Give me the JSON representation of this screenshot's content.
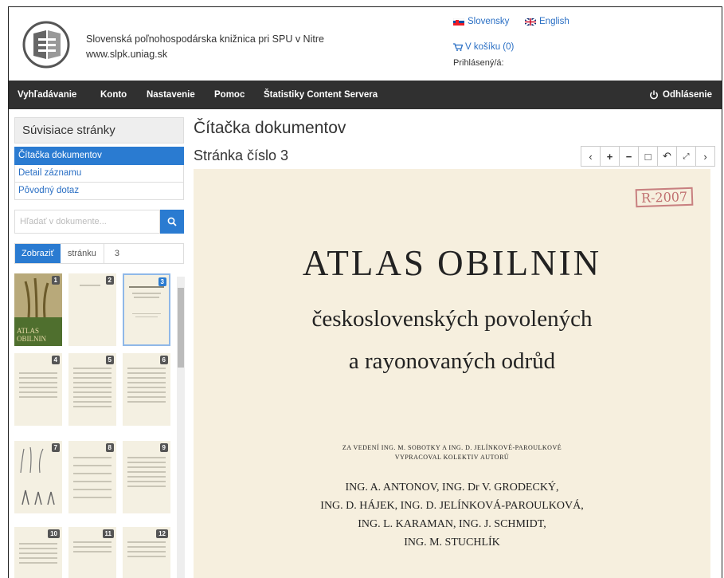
{
  "header": {
    "library_name": "Slovenská poľnohospodárska knižnica pri SPU v Nitre",
    "library_url": "www.slpk.uniag.sk",
    "lang_sk": "Slovensky",
    "lang_en": "English",
    "cart": "V košíku (0)",
    "logged_in": "Prihlásený/á:"
  },
  "nav": {
    "items": [
      "Vyhľadávanie",
      "Konto",
      "Nastavenie",
      "Pomoc",
      "Štatistiky Content Servera"
    ],
    "logout": "Odhlásenie"
  },
  "sidebar": {
    "title": "Súvisiace stránky",
    "links": [
      "Čítačka dokumentov",
      "Detail záznamu",
      "Pôvodný dotaz"
    ],
    "search_placeholder": "Hľadať v dokumente...",
    "show_button": "Zobraziť",
    "page_label": "stránku",
    "page_value": "3",
    "thumbnails": [
      {
        "num": "1",
        "cover_title": "ATLAS OBILNIN"
      },
      {
        "num": "2"
      },
      {
        "num": "3",
        "selected": true
      },
      {
        "num": "4"
      },
      {
        "num": "5"
      },
      {
        "num": "6"
      },
      {
        "num": "7"
      },
      {
        "num": "8"
      },
      {
        "num": "9"
      },
      {
        "num": "10"
      },
      {
        "num": "11"
      },
      {
        "num": "12"
      }
    ]
  },
  "content": {
    "title": "Čítačka dokumentov",
    "page_heading": "Stránka číslo 3",
    "toolbar": [
      "prev-icon",
      "zoom-in-icon",
      "zoom-out-icon",
      "fit-icon",
      "rotate-icon",
      "fullscreen-icon",
      "next-icon"
    ],
    "document": {
      "stamp": "R-2007",
      "title": "ATLAS OBILNIN",
      "subtitle1": "československých povolených",
      "subtitle2": "a rayonovaných odrůd",
      "credit1": "ZA VEDENÍ ING. M. SOBOTKY A ING. D. JELÍNKOVÉ-PAROULKOVÉ",
      "credit2": "VYPRACOVAL KOLEKTIV AUTORŮ",
      "authors": [
        "ING. A. ANTONOV, ING. Dr V. GRODECKÝ,",
        "ING. D. HÁJEK, ING. D. JELÍNKOVÁ-PAROULKOVÁ,",
        "ING. L. KARAMAN, ING. J. SCHMIDT,",
        "ING. M. STUCHLÍK"
      ]
    }
  },
  "colors": {
    "accent": "#2a7bd1",
    "navbar": "#303030",
    "paper": "#f6efde"
  }
}
